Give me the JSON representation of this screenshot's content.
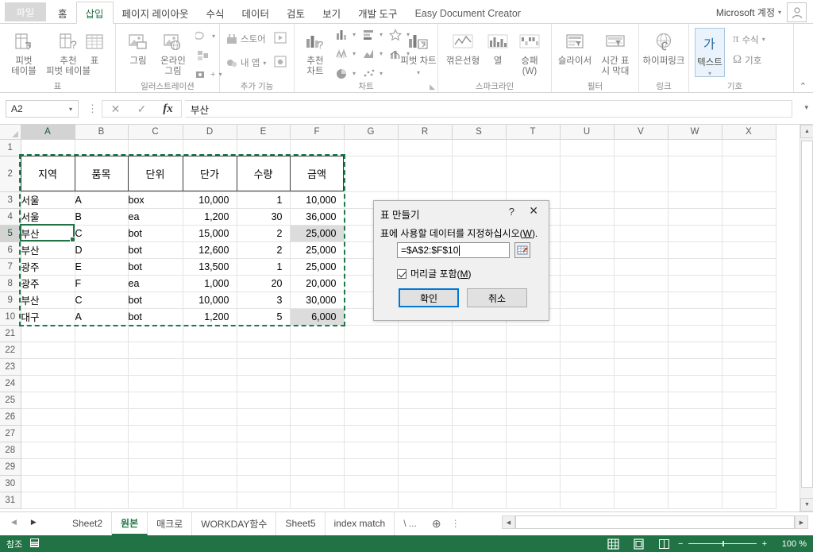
{
  "window": {
    "account_label": "Microsoft 계정",
    "account_caret": "▾"
  },
  "ribbon_tabs": {
    "file": "파일",
    "items": [
      {
        "label": "홈",
        "active": false
      },
      {
        "label": "삽입",
        "active": true
      },
      {
        "label": "페이지 레이아웃",
        "active": false
      },
      {
        "label": "수식",
        "active": false
      },
      {
        "label": "데이터",
        "active": false
      },
      {
        "label": "검토",
        "active": false
      },
      {
        "label": "보기",
        "active": false
      },
      {
        "label": "개발 도구",
        "active": false
      },
      {
        "label": "Easy Document Creator",
        "active": false
      }
    ]
  },
  "ribbon": {
    "groups": [
      {
        "name": "표",
        "label": "표"
      },
      {
        "name": "일러스트레이션",
        "label": "일러스트레이션"
      },
      {
        "name": "추가 기능",
        "label": "추가 기능"
      },
      {
        "name": "차트",
        "label": "차트"
      },
      {
        "name": "스파크라인",
        "label": "스파크라인"
      },
      {
        "name": "필터",
        "label": "필터"
      },
      {
        "name": "링크",
        "label": "링크"
      },
      {
        "name": "기호",
        "label": "기호"
      }
    ],
    "table_group": {
      "pivot_table": "피벗\n테이블",
      "pivot_table_l1": "피벗",
      "pivot_table_l2": "테이블",
      "recommended_pivot_l1": "추천",
      "recommended_pivot_l2": "피벗 테이블",
      "table": "표"
    },
    "illustration_group": {
      "picture_l1": "그림",
      "online_picture_l1": "온라인",
      "online_picture_l2": "그림"
    },
    "addins_group": {
      "store": "스토어",
      "my_apps": "내 앱"
    },
    "chart_group": {
      "recommended_chart_l1": "추천",
      "recommended_chart_l2": "차트",
      "pivot_chart": "피벗 차트"
    },
    "sparkline_group": {
      "line": "꺾은선형",
      "column": "열",
      "win_loss_l1": "승패",
      "win_loss_l2": "(W)"
    },
    "filter_group": {
      "slicer": "슬라이서",
      "timeline_l1": "시간 표",
      "timeline_l2": "시 막대"
    },
    "link_group": {
      "hyperlink": "하이퍼링크"
    },
    "symbol_group": {
      "text": "텍스트",
      "equation": "수식",
      "symbol": "기호",
      "pi": "π",
      "omega": "Ω"
    },
    "collapse_arrow": "⌃"
  },
  "formula_bar": {
    "name_box": "A2",
    "name_box_caret": "▾",
    "cancel": "✕",
    "confirm": "✓",
    "fx": "fx",
    "value": "부산",
    "expand": "▾",
    "dots": "⋮"
  },
  "sheet": {
    "columns": [
      "A",
      "B",
      "C",
      "D",
      "E",
      "F",
      "G",
      "R",
      "S",
      "T",
      "U",
      "V",
      "W",
      "X"
    ],
    "selected_column": "A",
    "selected_row": "5",
    "rows": [
      {
        "num": "1",
        "cells": [
          "",
          "",
          "",
          "",
          "",
          "",
          "",
          "",
          "",
          "",
          "",
          "",
          "",
          ""
        ]
      },
      {
        "num": "2",
        "cells": [
          "지역",
          "품목",
          "단위",
          "단가",
          "수량",
          "금액",
          "",
          "",
          "",
          "",
          "",
          "",
          "",
          ""
        ]
      },
      {
        "num": "3",
        "cells": [
          "서울",
          "A",
          "box",
          "10,000",
          "1",
          "10,000",
          "",
          "",
          "",
          "",
          "",
          "",
          "",
          ""
        ]
      },
      {
        "num": "4",
        "cells": [
          "서울",
          "B",
          "ea",
          "1,200",
          "30",
          "36,000",
          "",
          "",
          "",
          "",
          "",
          "",
          "",
          ""
        ]
      },
      {
        "num": "5",
        "cells": [
          "부산",
          "C",
          "bot",
          "15,000",
          "2",
          "25,000",
          "",
          "",
          "",
          "",
          "",
          "",
          "",
          ""
        ]
      },
      {
        "num": "6",
        "cells": [
          "부산",
          "D",
          "bot",
          "12,600",
          "2",
          "25,000",
          "",
          "",
          "",
          "",
          "",
          "",
          "",
          ""
        ]
      },
      {
        "num": "7",
        "cells": [
          "광주",
          "E",
          "bot",
          "13,500",
          "1",
          "25,000",
          "",
          "",
          "",
          "",
          "",
          "",
          "",
          ""
        ]
      },
      {
        "num": "8",
        "cells": [
          "광주",
          "F",
          "ea",
          "1,000",
          "20",
          "20,000",
          "",
          "",
          "",
          "",
          "",
          "",
          "",
          ""
        ]
      },
      {
        "num": "9",
        "cells": [
          "부산",
          "C",
          "bot",
          "10,000",
          "3",
          "30,000",
          "",
          "",
          "",
          "",
          "",
          "",
          "",
          ""
        ]
      },
      {
        "num": "10",
        "cells": [
          "대구",
          "A",
          "bot",
          "1,200",
          "5",
          "6,000",
          "",
          "",
          "",
          "",
          "",
          "",
          "",
          ""
        ]
      },
      {
        "num": "21",
        "cells": [
          "",
          "",
          "",
          "",
          "",
          "",
          "",
          "",
          "",
          "",
          "",
          "",
          "",
          ""
        ]
      },
      {
        "num": "22",
        "cells": [
          "",
          "",
          "",
          "",
          "",
          "",
          "",
          "",
          "",
          "",
          "",
          "",
          "",
          ""
        ]
      },
      {
        "num": "23",
        "cells": [
          "",
          "",
          "",
          "",
          "",
          "",
          "",
          "",
          "",
          "",
          "",
          "",
          "",
          ""
        ]
      },
      {
        "num": "24",
        "cells": [
          "",
          "",
          "",
          "",
          "",
          "",
          "",
          "",
          "",
          "",
          "",
          "",
          "",
          ""
        ]
      },
      {
        "num": "25",
        "cells": [
          "",
          "",
          "",
          "",
          "",
          "",
          "",
          "",
          "",
          "",
          "",
          "",
          "",
          ""
        ]
      },
      {
        "num": "26",
        "cells": [
          "",
          "",
          "",
          "",
          "",
          "",
          "",
          "",
          "",
          "",
          "",
          "",
          "",
          ""
        ]
      },
      {
        "num": "27",
        "cells": [
          "",
          "",
          "",
          "",
          "",
          "",
          "",
          "",
          "",
          "",
          "",
          "",
          "",
          ""
        ]
      },
      {
        "num": "28",
        "cells": [
          "",
          "",
          "",
          "",
          "",
          "",
          "",
          "",
          "",
          "",
          "",
          "",
          "",
          ""
        ]
      },
      {
        "num": "29",
        "cells": [
          "",
          "",
          "",
          "",
          "",
          "",
          "",
          "",
          "",
          "",
          "",
          "",
          "",
          ""
        ]
      },
      {
        "num": "30",
        "cells": [
          "",
          "",
          "",
          "",
          "",
          "",
          "",
          "",
          "",
          "",
          "",
          "",
          "",
          ""
        ]
      },
      {
        "num": "31",
        "cells": [
          "",
          "",
          "",
          "",
          "",
          "",
          "",
          "",
          "",
          "",
          "",
          "",
          "",
          ""
        ]
      }
    ],
    "shaded_cells": [
      "4:5",
      "9:5"
    ]
  },
  "dialog": {
    "title": "표 만들기",
    "help": "?",
    "close": "✕",
    "prompt_a": "표에 사용할 데이터를 지정하십시오(",
    "prompt_key": "W",
    "prompt_b": ").",
    "range_value": "=$A$2:$F$10",
    "checkbox_a": "머리글 포함(",
    "checkbox_key": "M",
    "checkbox_b": ")",
    "ok": "확인",
    "cancel": "취소"
  },
  "sheet_tabs": {
    "first": "◀",
    "prev": "◀",
    "next": "▶",
    "items": [
      {
        "label": "Sheet2",
        "active": false
      },
      {
        "label": "원본",
        "active": true
      },
      {
        "label": "매크로",
        "active": false
      },
      {
        "label": "WORKDAY함수",
        "active": false
      },
      {
        "label": "Sheet5",
        "active": false
      },
      {
        "label": "index match",
        "active": false
      },
      {
        "label": "\\ ...",
        "active": false
      }
    ],
    "add": "⊕",
    "dots": "⋮"
  },
  "status_bar": {
    "mode": "참조",
    "zoom": "100 %",
    "minus": "−",
    "plus": "+"
  },
  "colors": {
    "excel_green": "#217346",
    "accent_blue": "#0078d7",
    "selection_green": "#1a7a4c"
  }
}
